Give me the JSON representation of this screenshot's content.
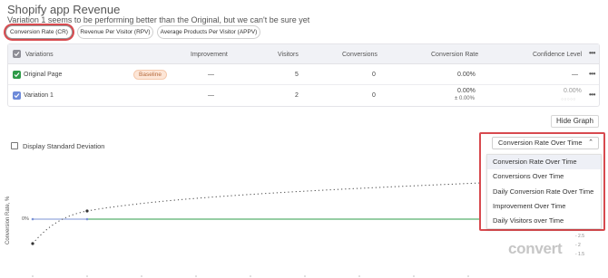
{
  "header": {
    "title": "Shopify app Revenue",
    "subtitle": "Variation 1 seems to be performing better than the Original, but we can't be sure yet"
  },
  "tabs": [
    {
      "label": "Conversion Rate (CR)",
      "active": true
    },
    {
      "label": "Revenue Per Visitor (RPV)",
      "active": false
    },
    {
      "label": "Average Products Per Visitor (APPV)",
      "active": false
    }
  ],
  "table": {
    "headers": {
      "variations": "Variations",
      "improvement": "Improvement",
      "visitors": "Visitors",
      "conversions": "Conversions",
      "conversion_rate": "Conversion Rate",
      "confidence": "Confidence Level"
    },
    "rows": [
      {
        "name": "Original Page",
        "badge": "Baseline",
        "improvement": "—",
        "visitors": "5",
        "conversions": "0",
        "conversion_rate": "0.00%",
        "confidence": "—"
      },
      {
        "name": "Variation 1",
        "improvement": "—",
        "visitors": "2",
        "conversions": "0",
        "conversion_rate": "0.00%",
        "conversion_rate_sub": "± 0.00%",
        "confidence": "0.00%"
      }
    ]
  },
  "controls": {
    "hide_graph": "Hide Graph",
    "std_dev": "Display Standard Deviation"
  },
  "graph_dropdown": {
    "selected": "Conversion Rate Over Time",
    "options": [
      "Conversion Rate Over Time",
      "Conversions Over Time",
      "Daily Conversion Rate Over Time",
      "Improvement Over Time",
      "Daily Visitors over Time"
    ]
  },
  "chart": {
    "ylabel": "Conversion Rate, %",
    "y_zero_label": "0%",
    "right_ticks": [
      "- 2.5",
      "- 2",
      "- 1.5"
    ]
  },
  "logo": "convert",
  "colors": {
    "accent_red": "#d84a4f",
    "green_line": "#2e9b48",
    "blue_line": "#7b93d6",
    "baseline_badge": "#fde6d7"
  }
}
